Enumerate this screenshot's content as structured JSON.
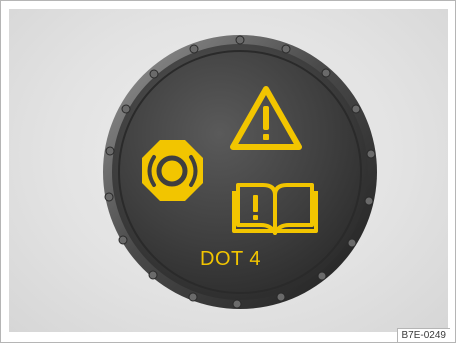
{
  "reservoir_cap": {
    "fluid_spec": "DOT 4",
    "symbols": [
      "brake-warning-icon",
      "warning-triangle-icon",
      "owners-manual-icon"
    ],
    "symbol_color": "#f2c500",
    "cap_color": "#3f3f3f"
  },
  "figure_code": "B7E-0249"
}
